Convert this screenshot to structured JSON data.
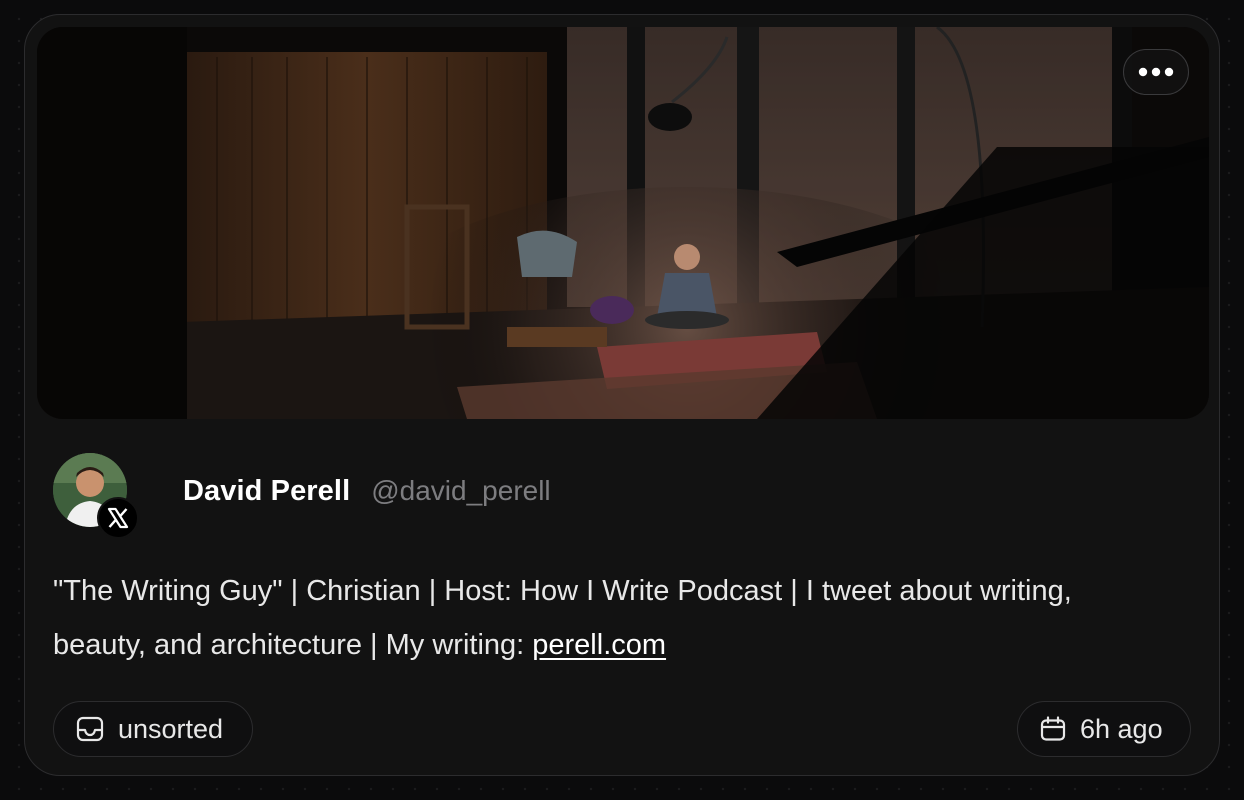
{
  "menu": {
    "icon": "more-horizontal-icon"
  },
  "author": {
    "name": "David Perell",
    "handle": "@david_perell",
    "platform_icon": "x-logo-icon"
  },
  "bio": {
    "text": "\"The Writing Guy\" | Christian | Host: How I Write Podcast | I tweet about writing, beauty, and architecture | My writing: ",
    "link_text": "perell.com"
  },
  "collection": {
    "label": "unsorted",
    "icon": "inbox-icon"
  },
  "timestamp": {
    "label": "6h ago",
    "icon": "calendar-icon"
  }
}
